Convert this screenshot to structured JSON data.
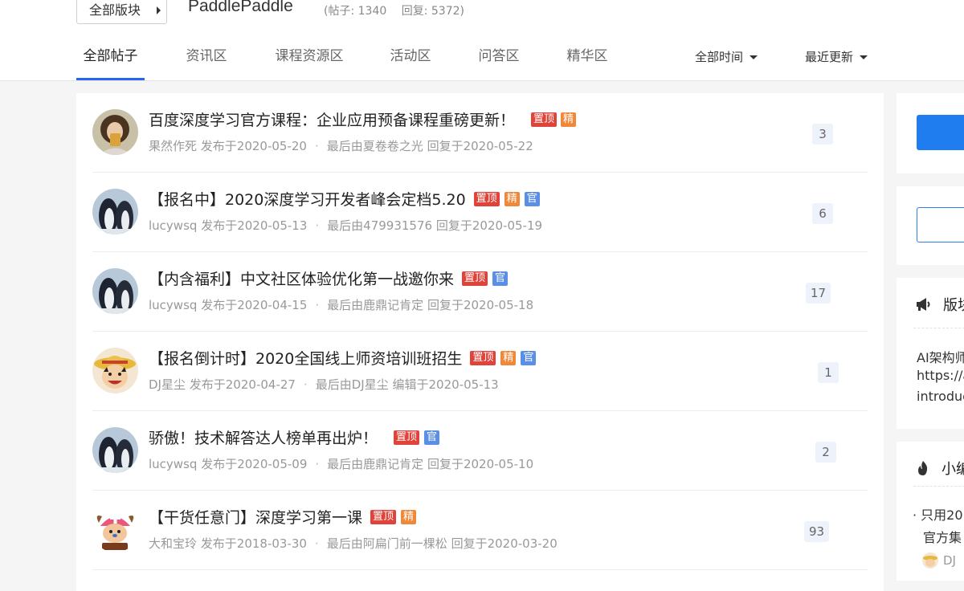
{
  "header": {
    "board_select_label": "全部版块",
    "forum_title": "PaddlePaddle",
    "posts_stat": "(帖子: 1340",
    "replies_stat": "回复: 5372)"
  },
  "tabs": [
    {
      "label": "全部帖子",
      "active": true
    },
    {
      "label": "资讯区"
    },
    {
      "label": "课程资源区"
    },
    {
      "label": "活动区"
    },
    {
      "label": "问答区"
    },
    {
      "label": "精华区"
    }
  ],
  "filters": {
    "time_label": "全部时间",
    "sort_label": "最近更新"
  },
  "badges": {
    "pin": "置顶",
    "essence": "精",
    "official": "官"
  },
  "posts": [
    {
      "title": "百度深度学习官方课程：企业应用预备课程重磅更新！",
      "badges": [
        "pin",
        "essence"
      ],
      "author": "果然作死",
      "posted": "发布于2020-05-20",
      "last_prefix": "最后由",
      "last_user": "夏卷卷之光",
      "last_action": "回复于2020-05-22",
      "replies": "3",
      "avatar": "photo-avatar"
    },
    {
      "title": "【报名中】2020深度学习开发者峰会定档5.20",
      "badges": [
        "pin",
        "essence",
        "official"
      ],
      "author": "lucywsq",
      "posted": "发布于2020-05-13",
      "last_prefix": "最后由",
      "last_user": "479931576",
      "last_action": "回复于2020-05-19",
      "replies": "6",
      "avatar": "penguin-avatar"
    },
    {
      "title": "【内含福利】中文社区体验优化第一战邀你来",
      "badges": [
        "pin",
        "official"
      ],
      "author": "lucywsq",
      "posted": "发布于2020-04-15",
      "last_prefix": "最后由",
      "last_user": "鹿鼎记肯定",
      "last_action": "回复于2020-05-18",
      "replies": "17",
      "avatar": "penguin-avatar"
    },
    {
      "title": "【报名倒计时】2020全国线上师资培训班招生",
      "badges": [
        "pin",
        "essence",
        "official"
      ],
      "author": "DJ星尘",
      "posted": "发布于2020-04-27",
      "last_prefix": "最后由",
      "last_user": "DJ星尘",
      "last_action": "编辑于2020-05-13",
      "replies": "1",
      "avatar": "luffy-avatar"
    },
    {
      "title": "骄傲！技术解答达人榜单再出炉！",
      "badges": [
        "pin",
        "official"
      ],
      "author": "lucywsq",
      "posted": "发布于2020-05-09",
      "last_prefix": "最后由",
      "last_user": "鹿鼎记肯定",
      "last_action": "回复于2020-05-10",
      "replies": "2",
      "avatar": "penguin-avatar"
    },
    {
      "title": "【干货任意门】深度学习第一课",
      "badges": [
        "pin",
        "essence"
      ],
      "author": "大和宝玲",
      "posted": "发布于2018-03-30",
      "last_prefix": "最后由",
      "last_user": "阿扁门前一棵松",
      "last_action": "回复于2020-03-20",
      "replies": "93",
      "avatar": "chopper-avatar"
    }
  ],
  "sidebar": {
    "notice_title": "版块",
    "notice_lines": [
      "AI架构师",
      "https://a",
      "introduc"
    ],
    "hot_title": "小编",
    "hot_lines": [
      "· 只用20",
      "官方集"
    ],
    "hot_user": "DJ"
  },
  "colors": {
    "accent": "#2468f2",
    "pin_badge": "#e0433a",
    "essence_badge": "#f0883a",
    "official_badge": "#5b8fe6"
  }
}
